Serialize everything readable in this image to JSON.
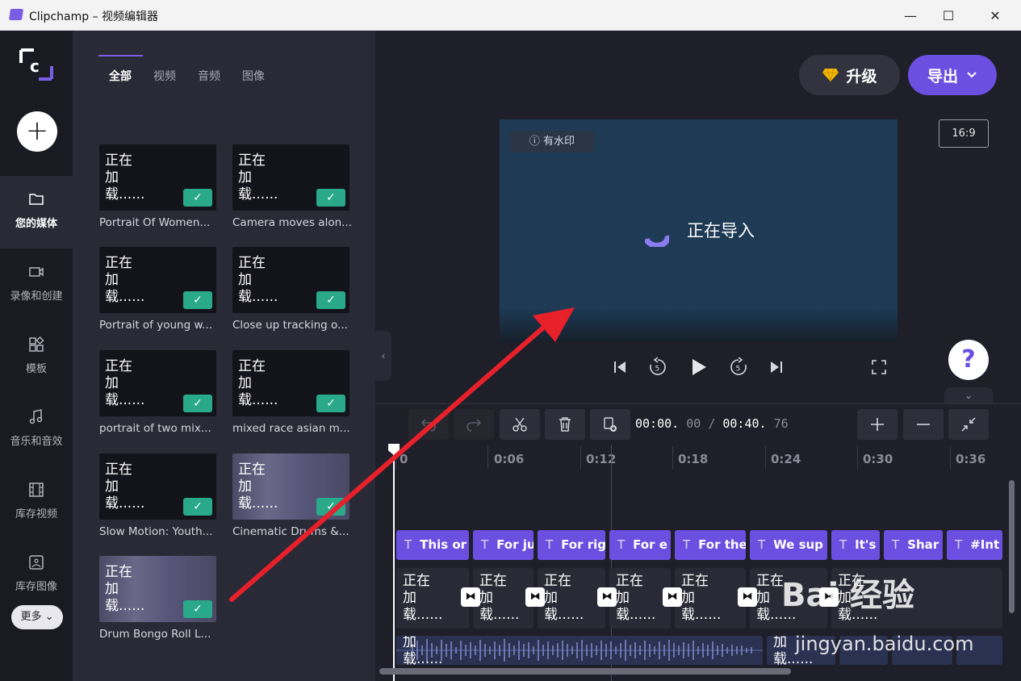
{
  "window": {
    "title": "Clipchamp – 视频编辑器",
    "minimize": "—",
    "maximize": "☐",
    "close": "✕"
  },
  "rail": {
    "add": "+",
    "items": [
      {
        "label": "您的媒体",
        "icon": "folder-icon"
      },
      {
        "label": "录像和创建",
        "icon": "camera-icon"
      },
      {
        "label": "模板",
        "icon": "template-icon"
      },
      {
        "label": "音乐和音效",
        "icon": "music-icon"
      },
      {
        "label": "库存视频",
        "icon": "film-icon"
      },
      {
        "label": "库存图像",
        "icon": "image-icon"
      }
    ],
    "more": "更多 ⌄"
  },
  "media": {
    "tabs": [
      "全部",
      "视频",
      "音频",
      "图像"
    ],
    "loading_text": "正在\n加\n载......",
    "check": "✓",
    "items": [
      {
        "label": "Portrait Of Women..."
      },
      {
        "label": "Camera moves alon..."
      },
      {
        "label": "Portrait of young w..."
      },
      {
        "label": "Close up tracking o..."
      },
      {
        "label": "portrait of two mix..."
      },
      {
        "label": "mixed race asian m..."
      },
      {
        "label": "Slow Motion: Youth..."
      },
      {
        "label": "Cinematic Drums &..."
      },
      {
        "label": "Drum Bongo Roll L..."
      }
    ]
  },
  "header": {
    "upgrade": "升级",
    "export": "导出",
    "aspect": "16:9"
  },
  "preview": {
    "watermark": "ⓘ 有水印",
    "importing": "正在导入"
  },
  "help": "?",
  "timeline": {
    "time_current": "00:00.",
    "time_current_ms": "00",
    "separator": "/",
    "time_total": "00:40.",
    "time_total_ms": "76",
    "ruler": [
      "0",
      "0:06",
      "0:12",
      "0:18",
      "0:24",
      "0:30",
      "0:36"
    ],
    "text_clips": [
      "This or",
      "For ju",
      "For rig",
      "For e",
      "For the",
      "We sup",
      "It's",
      "Shar",
      "#Int"
    ],
    "text_icon": "T",
    "video_loading": "正在\n加\n载......",
    "audio_loading": "加\n载......",
    "audio_loading_2": "加\n载......"
  },
  "overlay": {
    "baidu": "Bai  经验",
    "baidu_sub": "jingyan.baidu.com"
  },
  "colors": {
    "accent": "#6a4fe0",
    "check": "#29a88a",
    "arrow": "#e8202a"
  }
}
